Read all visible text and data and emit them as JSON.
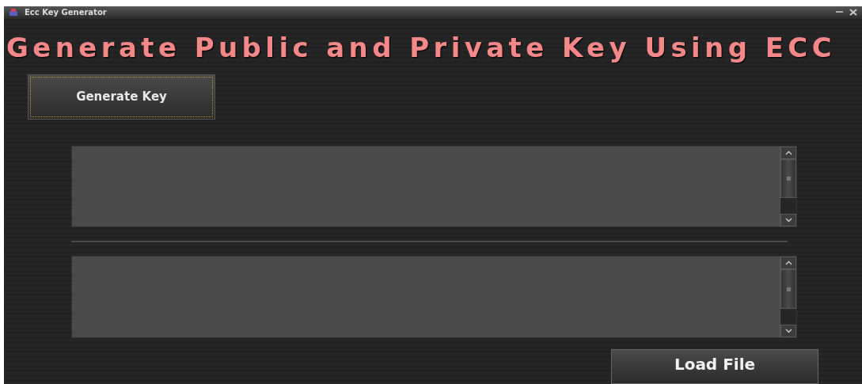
{
  "window": {
    "title": "Ecc Key Generator"
  },
  "heading": "Generate Public and Private Key Using ECC",
  "generate_button": {
    "label": "Generate Key",
    "focused": true
  },
  "key_fields": [
    {
      "kind": "text_area"
    },
    {
      "kind": "text_area"
    }
  ],
  "load_button": {
    "label": "Load File"
  }
}
